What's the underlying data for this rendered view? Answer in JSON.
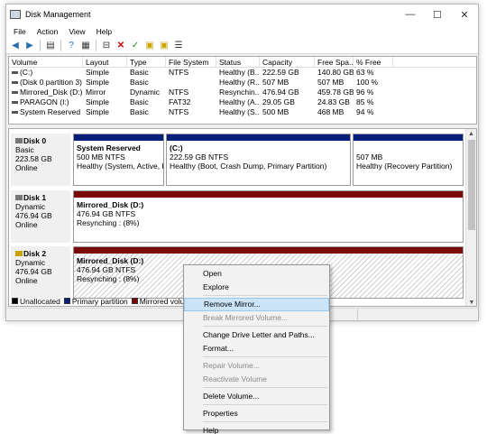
{
  "window": {
    "title": "Disk Management",
    "controls": {
      "minimize": "—",
      "maximize": "☐",
      "close": "✕"
    }
  },
  "menu": [
    "File",
    "Action",
    "View",
    "Help"
  ],
  "volumes": {
    "headers": [
      "Volume",
      "Layout",
      "Type",
      "File System",
      "Status",
      "Capacity",
      "Free Spa...",
      "% Free"
    ],
    "rows": [
      [
        "(C:)",
        "Simple",
        "Basic",
        "NTFS",
        "Healthy (B...",
        "222.59 GB",
        "140.80 GB",
        "63 %"
      ],
      [
        "(Disk 0 partition 3)",
        "Simple",
        "Basic",
        "",
        "Healthy (R...",
        "507 MB",
        "507 MB",
        "100 %"
      ],
      [
        "Mirrored_Disk (D:)",
        "Mirror",
        "Dynamic",
        "NTFS",
        "Resynchin...",
        "476.94 GB",
        "459.78 GB",
        "96 %"
      ],
      [
        "PARAGON (I:)",
        "Simple",
        "Basic",
        "FAT32",
        "Healthy (A...",
        "29.05 GB",
        "24.83 GB",
        "85 %"
      ],
      [
        "System Reserved",
        "Simple",
        "Basic",
        "NTFS",
        "Healthy (S...",
        "500 MB",
        "468 MB",
        "94 %"
      ]
    ]
  },
  "disks": [
    {
      "name": "Disk 0",
      "type": "Basic",
      "size": "223.58 GB",
      "status": "Online",
      "partitions": [
        {
          "name": "System Reserved",
          "size": "500 MB NTFS",
          "status": "Healthy (System, Active, Pri"
        },
        {
          "name": "(C:)",
          "size": "222.59 GB NTFS",
          "status": "Healthy (Boot, Crash Dump, Primary Partition)"
        },
        {
          "name": "",
          "size": "507 MB",
          "status": "Healthy (Recovery Partition)"
        }
      ]
    },
    {
      "name": "Disk 1",
      "type": "Dynamic",
      "size": "476.94 GB",
      "status": "Online",
      "partitions": [
        {
          "name": "Mirrored_Disk (D:)",
          "size": "476.94 GB NTFS",
          "status": "Resynching : (8%)"
        }
      ]
    },
    {
      "name": "Disk 2",
      "type": "Dynamic",
      "size": "476.94 GB",
      "status": "Online",
      "partitions": [
        {
          "name": "Mirrored_Disk (D:)",
          "size": "476.94 GB NTFS",
          "status": "Resynching : (8%)"
        }
      ]
    }
  ],
  "legend": [
    {
      "label": "Unallocated",
      "color": "#000000"
    },
    {
      "label": "Primary partition",
      "color": "#0a1f7a"
    },
    {
      "label": "Mirrored volume",
      "color": "#7a0a0a"
    }
  ],
  "context_menu": {
    "open": "Open",
    "explore": "Explore",
    "remove_mirror": "Remove Mirror...",
    "break_mirror": "Break Mirrored Volume...",
    "change_letter": "Change Drive Letter and Paths...",
    "format": "Format...",
    "repair": "Repair Volume...",
    "reactivate": "Reactivate Volume",
    "delete": "Delete Volume...",
    "properties": "Properties",
    "help": "Help"
  }
}
